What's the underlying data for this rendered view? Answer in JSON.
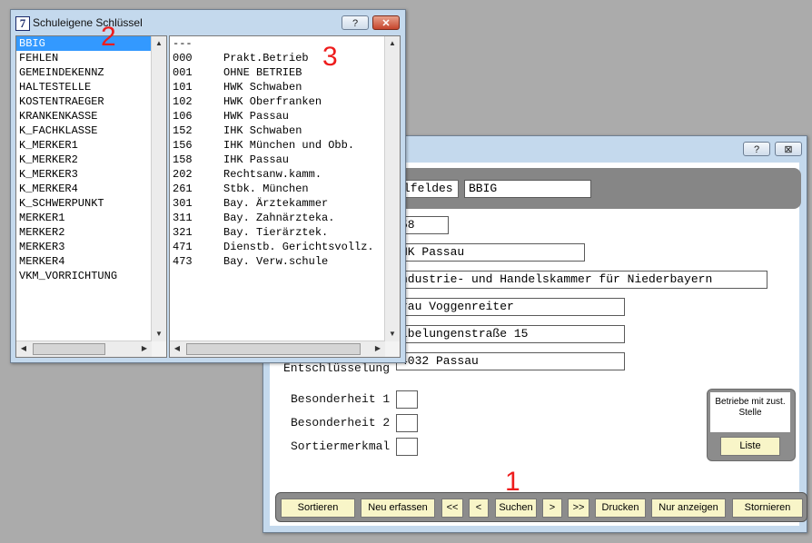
{
  "main_window": {
    "help_label": "?",
    "close_label": "⊠",
    "banner_label": "lfeldes",
    "banner_value": "BBIG",
    "fields": [
      "58",
      "HK Passau",
      "ndustrie- und Handelskammer für Niederbayern",
      "rau Voggenreiter",
      "ibelungenstraße 15",
      "4032 Passau"
    ],
    "entschl_label": "Entschlüsselung",
    "besonderheit1_label": "Besonderheit 1",
    "besonderheit2_label": "Besonderheit 2",
    "sortiermerkmal_label": "Sortiermerkmal",
    "side_panel": {
      "text": "Betriebe mit zust. Stelle",
      "button": "Liste"
    },
    "toolbar": [
      "Sortieren",
      "Neu erfassen",
      "<<",
      "<",
      "Suchen",
      ">",
      ">>",
      "Drucken",
      "Nur anzeigen",
      "Stornieren"
    ]
  },
  "keys_window": {
    "icon_glyph": "7",
    "title": "Schuleigene Schlüssel",
    "help_label": "?",
    "close_label": "✕",
    "left_items": [
      "BBIG",
      "FEHLEN",
      "GEMEINDEKENNZ",
      "HALTESTELLE",
      "KOSTENTRAEGER",
      "KRANKENKASSE",
      "K_FACHKLASSE",
      "K_MERKER1",
      "K_MERKER2",
      "K_MERKER3",
      "K_MERKER4",
      "K_SCHWERPUNKT",
      "MERKER1",
      "MERKER2",
      "MERKER3",
      "MERKER4",
      "VKM_VORRICHTUNG"
    ],
    "selected_left": "BBIG",
    "right_rows": [
      {
        "code": "---",
        "text": ""
      },
      {
        "code": "000",
        "text": "Prakt.Betrieb"
      },
      {
        "code": "001",
        "text": "OHNE BETRIEB"
      },
      {
        "code": "101",
        "text": "HWK Schwaben"
      },
      {
        "code": "102",
        "text": "HWK Oberfranken"
      },
      {
        "code": "106",
        "text": "HWK Passau"
      },
      {
        "code": "152",
        "text": "IHK Schwaben"
      },
      {
        "code": "156",
        "text": "IHK München und Obb."
      },
      {
        "code": "158",
        "text": "IHK Passau"
      },
      {
        "code": "202",
        "text": "Rechtsanw.kamm."
      },
      {
        "code": "261",
        "text": "Stbk. München"
      },
      {
        "code": "301",
        "text": "Bay. Ärztekammer"
      },
      {
        "code": "311",
        "text": "Bay. Zahnärzteka."
      },
      {
        "code": "321",
        "text": "Bay. Tierärztek."
      },
      {
        "code": "471",
        "text": "Dienstb. Gerichtsvollz."
      },
      {
        "code": "473",
        "text": "Bay. Verw.schule"
      }
    ]
  },
  "annotations": [
    "1",
    "2",
    "3"
  ],
  "colors": {
    "selection": "#3399ff",
    "button_yellow": "#f8f5c8",
    "annotation_red": "#ee1c1c"
  }
}
